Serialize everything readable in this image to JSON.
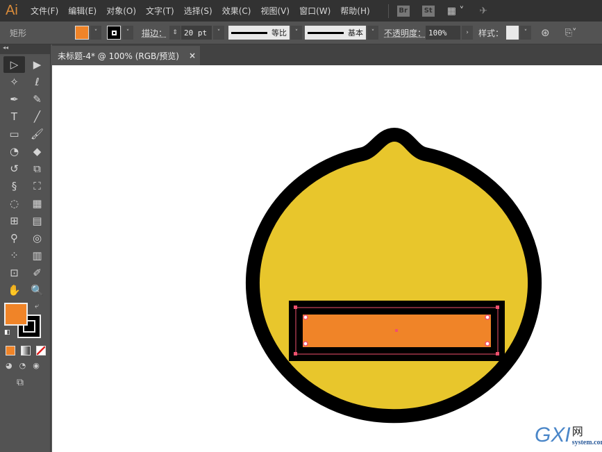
{
  "app": {
    "logo": "Ai"
  },
  "menu": [
    "文件(F)",
    "编辑(E)",
    "对象(O)",
    "文字(T)",
    "选择(S)",
    "效果(C)",
    "视图(V)",
    "窗口(W)",
    "帮助(H)"
  ],
  "menu_badges": [
    "Br",
    "St"
  ],
  "control": {
    "object_type": "矩形",
    "stroke_label": "描边：",
    "stroke_weight": "20 pt",
    "profile_label": "等比",
    "brush_label": "基本",
    "opacity_label": "不透明度：",
    "opacity_value": "100%",
    "style_label": "样式："
  },
  "document_tab": {
    "title": "未标题-4* @ 100% (RGB/预览)",
    "close": "×"
  },
  "colors": {
    "fill": "#f08428",
    "stroke": "#000000",
    "lemon": "#e8c62c",
    "selection": "#f0506e"
  },
  "tools": [
    {
      "name": "selection-tool",
      "glyph": "▷"
    },
    {
      "name": "direct-selection-tool",
      "glyph": "▶"
    },
    {
      "name": "magic-wand-tool",
      "glyph": "✧"
    },
    {
      "name": "lasso-tool",
      "glyph": "ℓ"
    },
    {
      "name": "pen-tool",
      "glyph": "✒"
    },
    {
      "name": "curvature-tool",
      "glyph": "✎"
    },
    {
      "name": "type-tool",
      "glyph": "T"
    },
    {
      "name": "line-tool",
      "glyph": "╱"
    },
    {
      "name": "rectangle-tool",
      "glyph": "▭"
    },
    {
      "name": "paintbrush-tool",
      "glyph": "🖌"
    },
    {
      "name": "shaper-tool",
      "glyph": "◔"
    },
    {
      "name": "eraser-tool",
      "glyph": "◆"
    },
    {
      "name": "rotate-tool",
      "glyph": "↺"
    },
    {
      "name": "scale-tool",
      "glyph": "⧉"
    },
    {
      "name": "warp-tool",
      "glyph": "§"
    },
    {
      "name": "free-transform-tool",
      "glyph": "⛶"
    },
    {
      "name": "shape-builder-tool",
      "glyph": "◌"
    },
    {
      "name": "perspective-grid-tool",
      "glyph": "▦"
    },
    {
      "name": "mesh-tool",
      "glyph": "⊞"
    },
    {
      "name": "gradient-tool",
      "glyph": "▤"
    },
    {
      "name": "eyedropper-tool",
      "glyph": "⚲"
    },
    {
      "name": "blend-tool",
      "glyph": "◎"
    },
    {
      "name": "symbol-sprayer-tool",
      "glyph": "⁘"
    },
    {
      "name": "column-graph-tool",
      "glyph": "▥"
    },
    {
      "name": "artboard-tool",
      "glyph": "⊡"
    },
    {
      "name": "slice-tool",
      "glyph": "✐"
    },
    {
      "name": "hand-tool",
      "glyph": "✋"
    },
    {
      "name": "zoom-tool",
      "glyph": "🔍"
    }
  ],
  "watermark": {
    "main": "GXI",
    "cn": "网",
    "sub": "system.com"
  }
}
